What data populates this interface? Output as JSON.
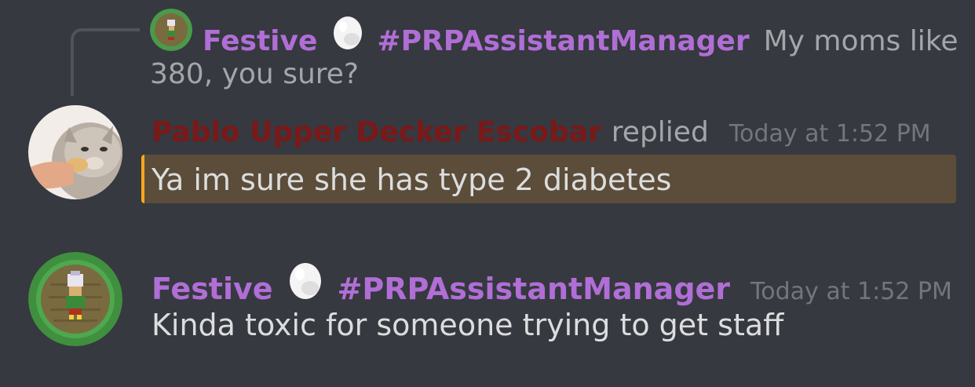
{
  "reply_preview": {
    "username": "Festive",
    "badge_icon": "egg-icon",
    "tag": "#PRPAssistantManager",
    "text_line1": "My moms like",
    "text_line2": "380, you sure?"
  },
  "message1": {
    "username": "Pablo Upper Decker Escobar",
    "replied_label": "replied",
    "timestamp": "Today at 1:52 PM",
    "text": "Ya im sure she has type 2 diabetes"
  },
  "message2": {
    "username": "Festive",
    "badge_icon": "egg-icon",
    "tag": "#PRPAssistantManager",
    "timestamp": "Today at 1:52 PM",
    "text": "Kinda toxic for someone trying to get staff"
  },
  "colors": {
    "background": "#36393f",
    "username_purple": "#b06ed6",
    "username_red": "#7b1818",
    "mention_highlight": "#5b4d39",
    "mention_bar": "#faa81a"
  }
}
